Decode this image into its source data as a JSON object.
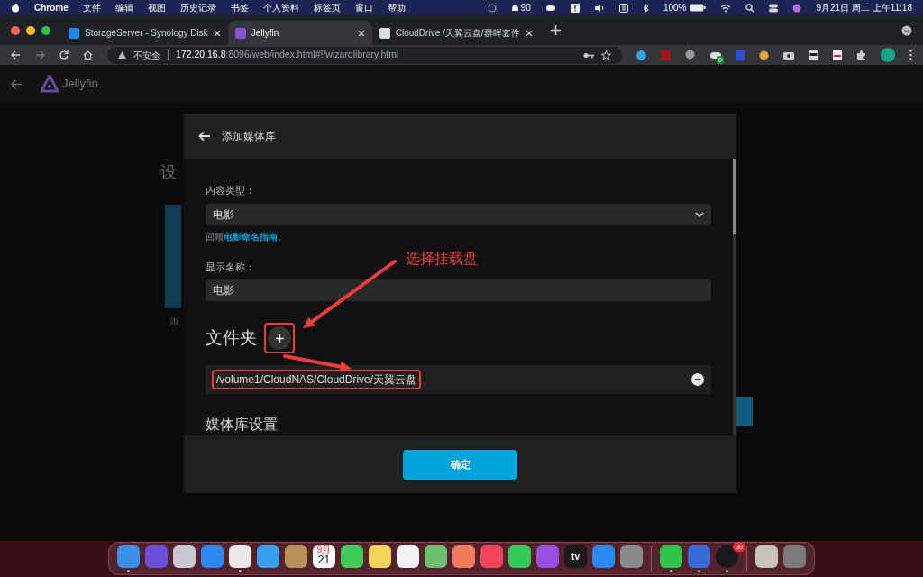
{
  "menu_bar": {
    "app": "Chrome",
    "menus": [
      "文件",
      "编辑",
      "视图",
      "历史记录",
      "书签",
      "个人资料",
      "标签页",
      "窗口",
      "帮助"
    ],
    "notification_count": "90",
    "battery": "100%",
    "clock": "9月21日 周二 上午11:18"
  },
  "browser": {
    "tabs": [
      {
        "title": "StorageServer - Synology Disk",
        "selected": false
      },
      {
        "title": "Jellyfin",
        "selected": true
      },
      {
        "title": "CloudDrive /天翼云盘/群晖套件",
        "selected": false
      }
    ],
    "security": "不安全",
    "url_host": "172.20.16.8",
    "url_rest": ":8096/web/index.html#!/wizardlibrary.html",
    "extension_badge": "0"
  },
  "app_header": {
    "brand": "Jellyfin"
  },
  "background": {
    "heading_fragment": "设",
    "card_fragment": "添"
  },
  "dialog": {
    "title": "添加媒体库",
    "content_type": {
      "label": "内容类型：",
      "value": "电影"
    },
    "help": {
      "prefix": "回顾",
      "link": "电影命名指南",
      "suffix": "。"
    },
    "display_name": {
      "label": "显示名称：",
      "value": "电影"
    },
    "folders": {
      "heading": "文件夹",
      "add_highlighted": true,
      "items": [
        {
          "path": "/volume1/CloudNAS/CloudDrive/天翼云盘",
          "highlighted": true
        }
      ]
    },
    "library_settings_heading": "媒体库设置",
    "confirm": "确定"
  },
  "callout": {
    "text": "选择挂载盘"
  },
  "dock": [
    {
      "kind": "app",
      "color": "#3b8fe8",
      "running": true
    },
    {
      "kind": "app",
      "color": "#6b4fd8",
      "running": false
    },
    {
      "kind": "app",
      "color": "#c8c8d0",
      "running": false
    },
    {
      "kind": "app",
      "color": "#2a8af0",
      "running": false
    },
    {
      "kind": "app",
      "color": "#e8e8e8",
      "running": true
    },
    {
      "kind": "app",
      "color": "#3aa0f0",
      "running": false
    },
    {
      "kind": "app",
      "color": "#b8925a",
      "running": false
    },
    {
      "kind": "calendar",
      "month": "9月",
      "day": "21",
      "running": false
    },
    {
      "kind": "app",
      "color": "#3ecb5a",
      "running": false
    },
    {
      "kind": "app",
      "color": "#f5d35a",
      "running": false
    },
    {
      "kind": "app",
      "color": "#f2f2f2",
      "running": false
    },
    {
      "kind": "app",
      "color": "#6cc070",
      "running": false
    },
    {
      "kind": "app",
      "color": "#f07a5a",
      "running": false
    },
    {
      "kind": "app",
      "color": "#f0445a",
      "running": false
    },
    {
      "kind": "app",
      "color": "#36c85a",
      "running": false
    },
    {
      "kind": "app",
      "color": "#9a4ee0",
      "running": false
    },
    {
      "kind": "tv",
      "label": "tv",
      "running": false
    },
    {
      "kind": "app",
      "color": "#2a8af0",
      "running": false
    },
    {
      "kind": "app",
      "color": "#8a8a8a",
      "running": false
    },
    {
      "kind": "separator"
    },
    {
      "kind": "app",
      "color": "#2ec44a",
      "running": true
    },
    {
      "kind": "app",
      "color": "#3a6ad8",
      "running": true
    },
    {
      "kind": "badge",
      "color": "#1a1a1a",
      "badge": "30",
      "running": true
    },
    {
      "kind": "separator"
    },
    {
      "kind": "app",
      "color": "#c9c2b8",
      "running": false
    },
    {
      "kind": "app",
      "color": "#7a7a7a",
      "running": false
    }
  ]
}
